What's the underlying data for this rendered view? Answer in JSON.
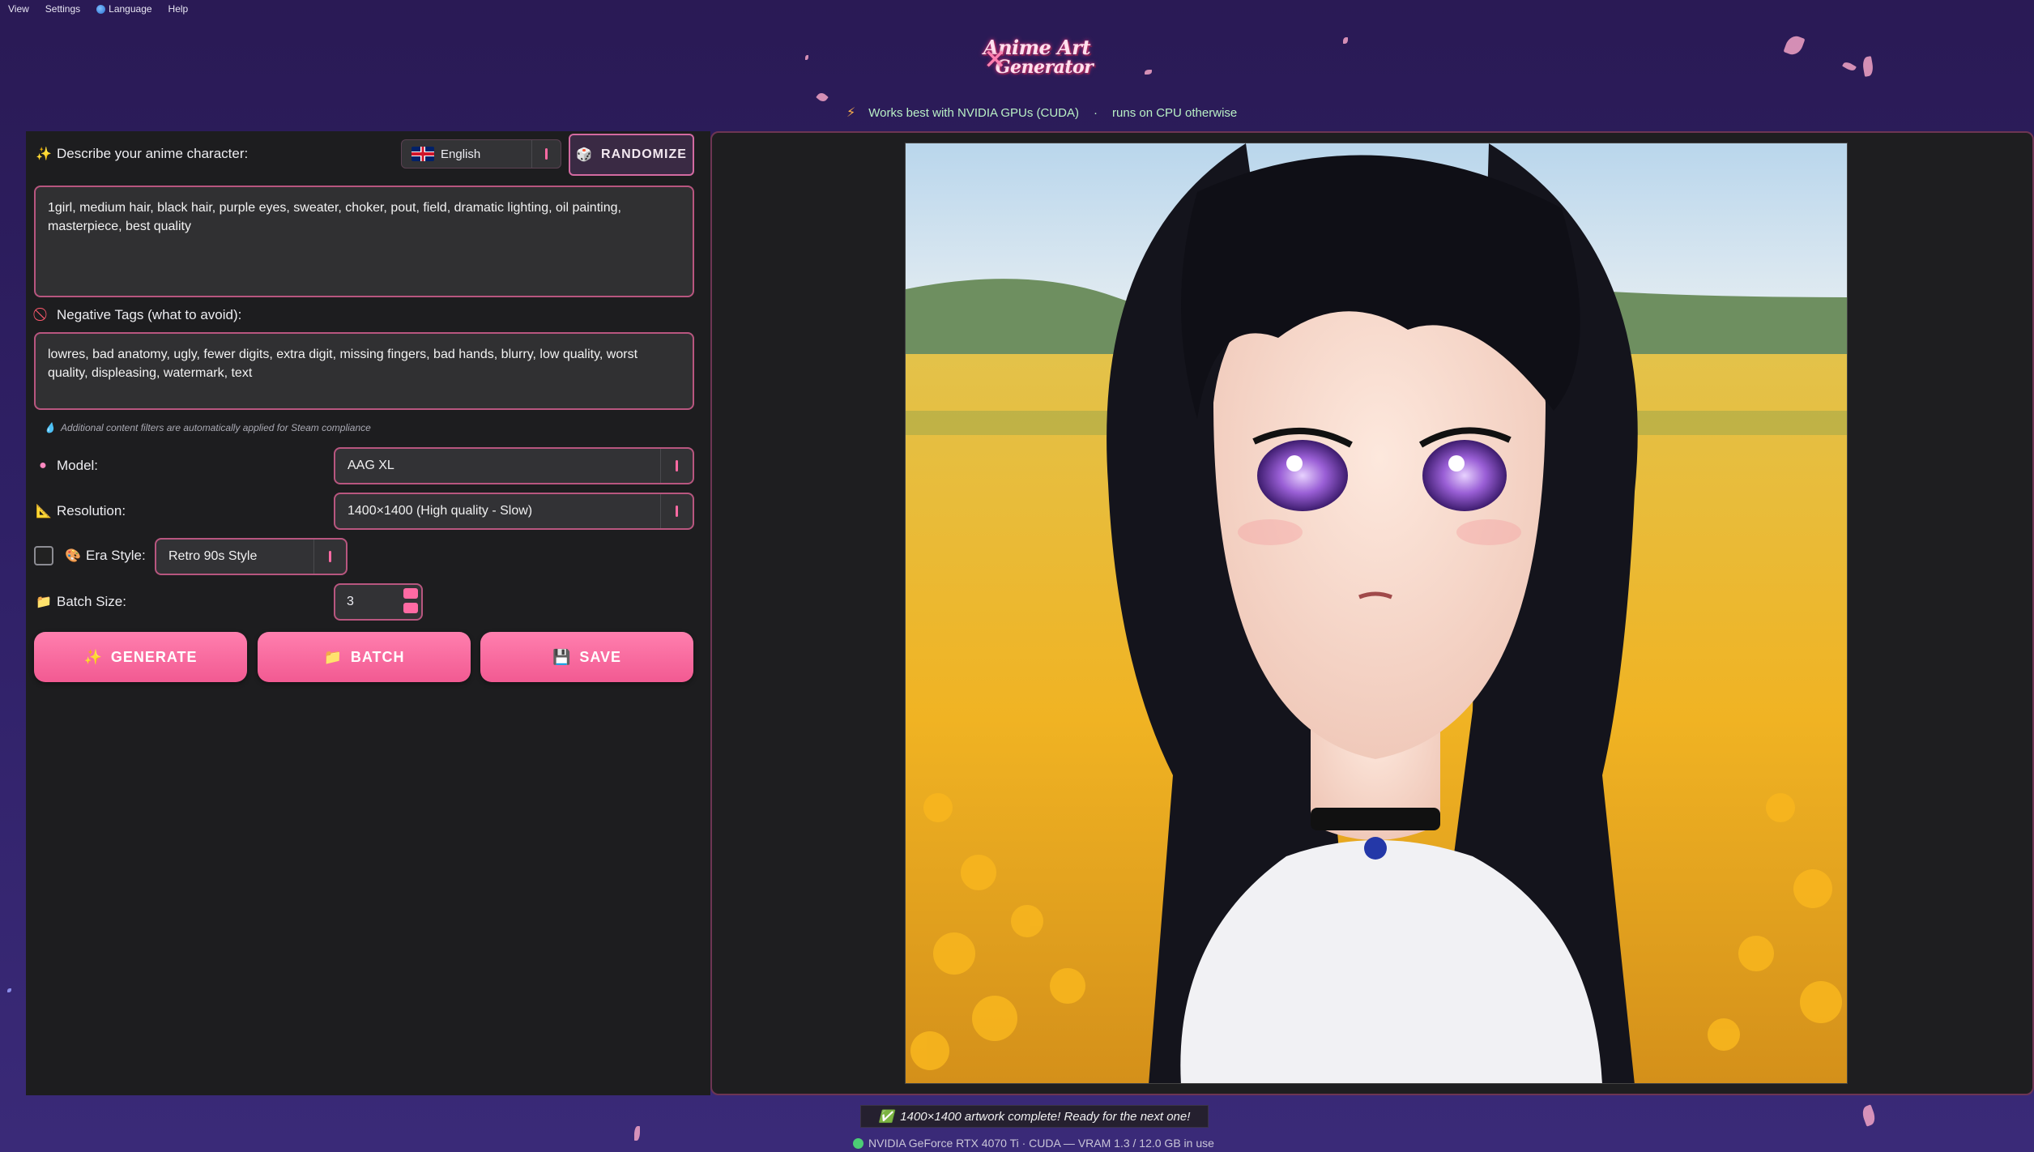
{
  "menu": {
    "view": "View",
    "settings": "Settings",
    "language": "Language",
    "help": "Help"
  },
  "logo": {
    "line1": "Anime Art",
    "line2": "Generator"
  },
  "subtitle": {
    "part1": "Works best with NVIDIA GPUs (CUDA)",
    "separator": "·",
    "part2": "runs on CPU otherwise"
  },
  "prompt": {
    "label": "Describe your anime character:",
    "language": "English",
    "randomize": "RANDOMIZE",
    "text": "1girl, medium hair, black hair, purple eyes, sweater, choker, pout, field, dramatic lighting, oil painting, masterpiece, best quality"
  },
  "negative": {
    "label": "Negative Tags (what to avoid):",
    "text": "lowres, bad anatomy, ugly, fewer digits, extra digit, missing fingers, bad hands, blurry, low quality, worst quality, displeasing, watermark, text"
  },
  "note": "Additional content filters are automatically applied for Steam compliance",
  "model": {
    "label": "Model:",
    "value": "AAG XL"
  },
  "resolution": {
    "label": "Resolution:",
    "value": "1400×1400 (High quality - Slow)"
  },
  "era": {
    "label": "Era Style:",
    "value": "Retro 90s Style",
    "checked": false
  },
  "batch": {
    "label": "Batch Size:",
    "value": "3"
  },
  "actions": {
    "generate": "GENERATE",
    "batch": "BATCH",
    "save": "SAVE"
  },
  "status": {
    "message": "1400×1400 artwork complete! Ready for the next one!",
    "gpu": "NVIDIA GeForce RTX 4070 Ti · CUDA — VRAM 1.3 / 12.0 GB in use"
  },
  "colors": {
    "accent": "#ff6aa3",
    "border": "#b8567f",
    "panel": "#1d1d1f",
    "background": "#2f2066"
  }
}
